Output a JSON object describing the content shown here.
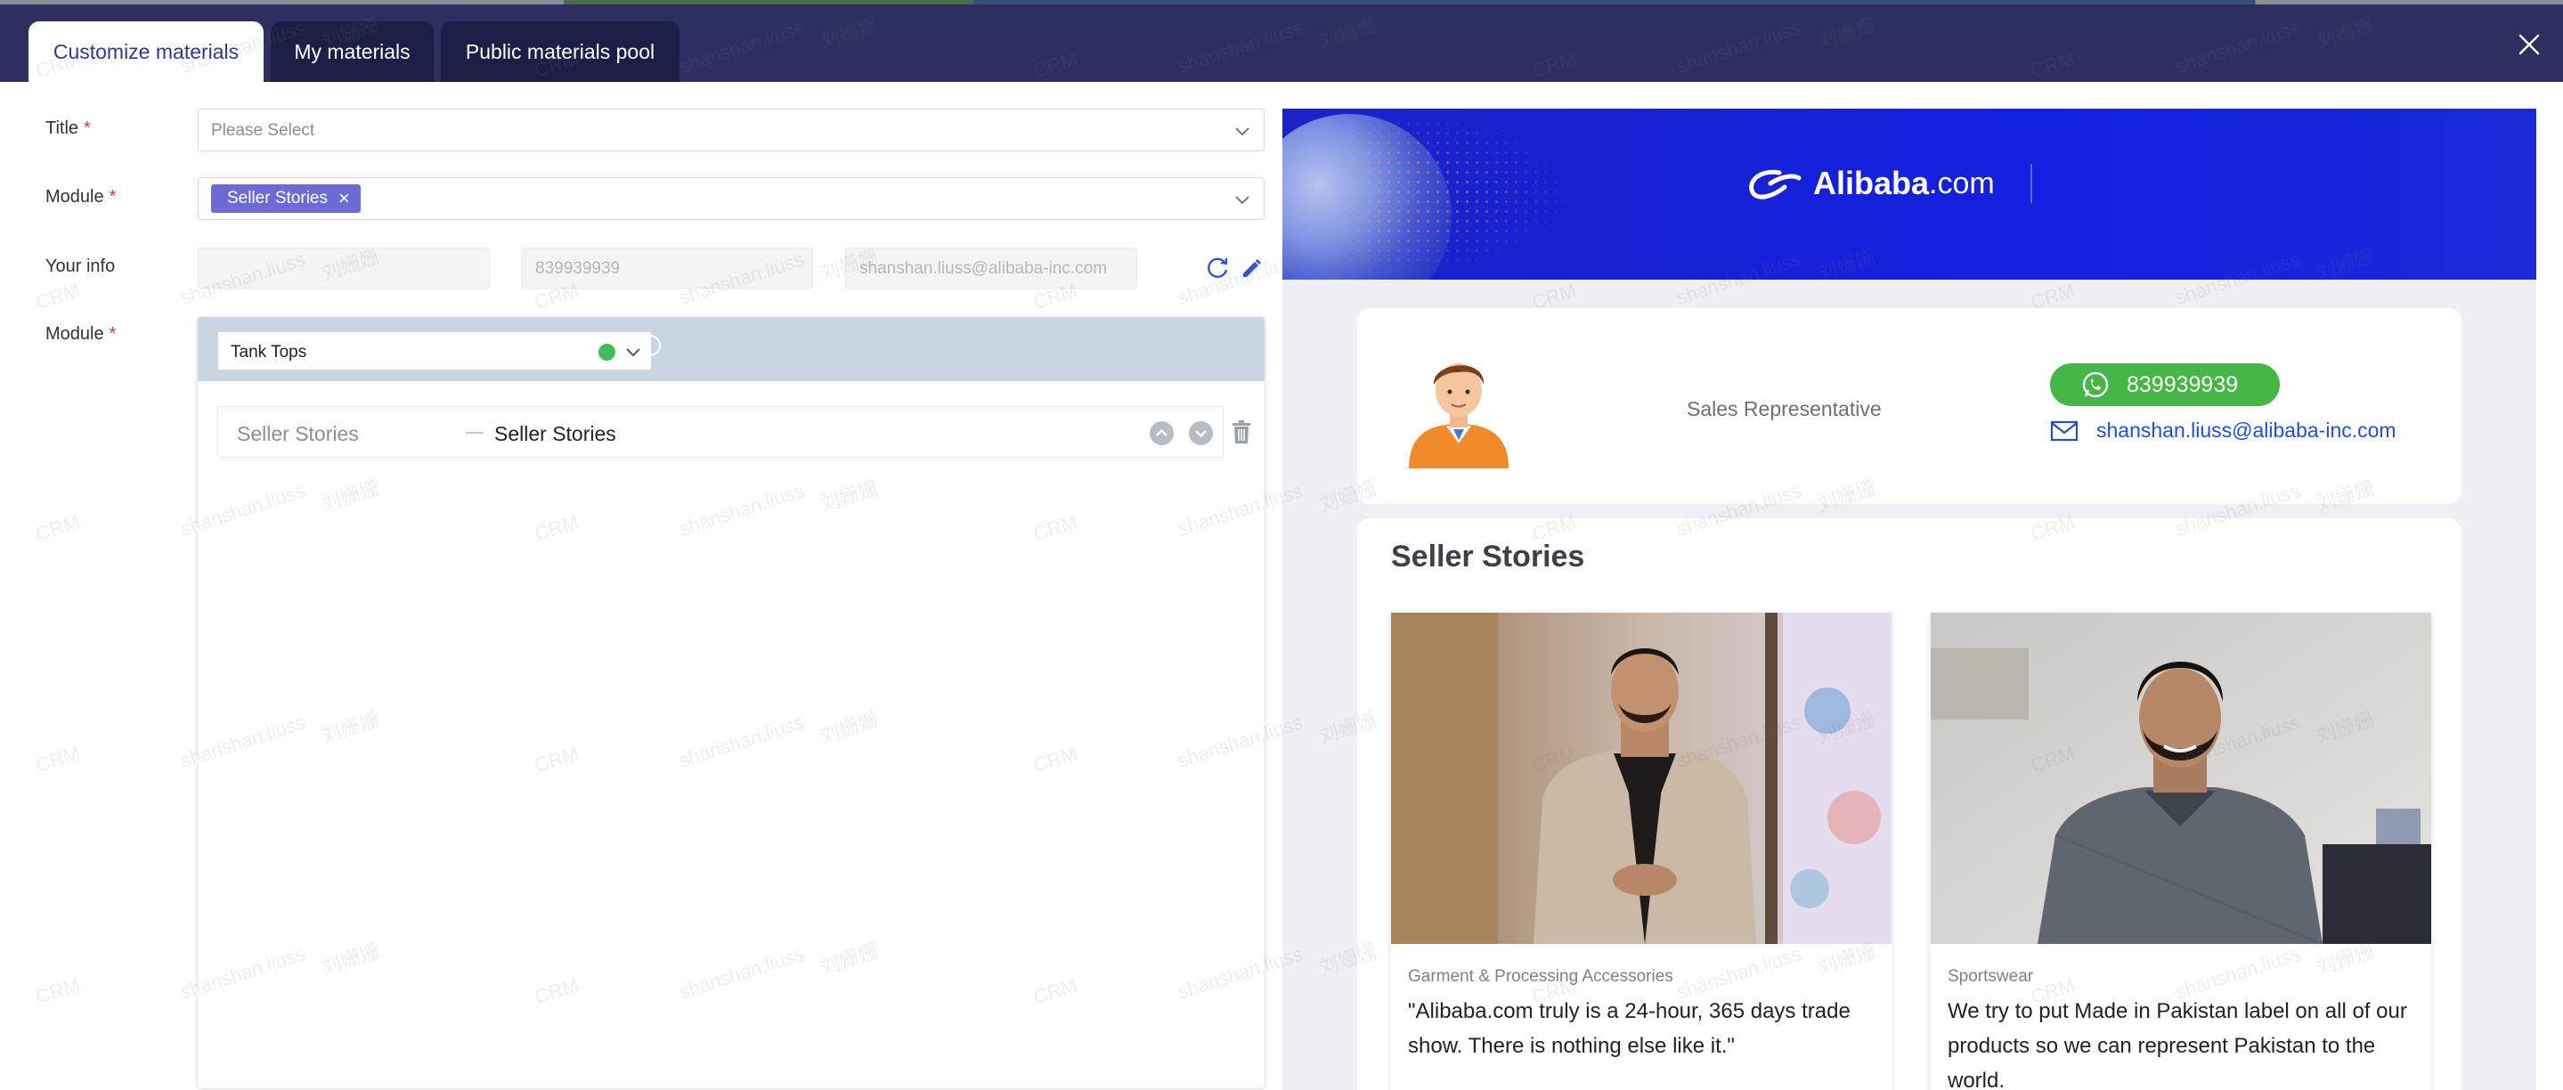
{
  "tabs": [
    {
      "label": "Customize materials",
      "active": true
    },
    {
      "label": "My materials",
      "active": false
    },
    {
      "label": "Public materials pool",
      "active": false
    }
  ],
  "form": {
    "title_label": "Title",
    "title_placeholder": "Please Select",
    "module_label": "Module",
    "module_tag": "Seller Stories",
    "your_info_label": "Your info",
    "info_name": "",
    "info_phone": "839939939",
    "info_email": "shanshan.liuss@alibaba-inc.com",
    "module2_label": "Module",
    "required_mark": "*"
  },
  "module_panel": {
    "selected": "Tank Tops",
    "row": {
      "left": "Seller Stories",
      "right": "Seller Stories"
    }
  },
  "preview": {
    "brand": "Alibaba",
    "brand_domain": ".com",
    "role": "Sales Representative",
    "whatsapp": "839939939",
    "email": "shanshan.liuss@alibaba-inc.com",
    "section_title": "Seller Stories",
    "stories": [
      {
        "category": "Garment & Processing Accessories",
        "quote": "\"Alibaba.com truly is a 24-hour, 365 days trade show. There is nothing else like it.\""
      },
      {
        "category": "Sportswear",
        "quote": "We try to put Made in Pakistan label on all of our products so we can represent Pakistan to the world."
      }
    ]
  },
  "watermark": {
    "crm": "CRM",
    "user": "shanshan.liuss",
    "name": "刘姗姗"
  },
  "colors": {
    "header_bg": "#2c2f5f",
    "tab_bg": "#1c1e45",
    "tag_bg": "#6c6ad6",
    "banner_bg": "#1420e0",
    "whatsapp_green": "#46b646",
    "link_blue": "#1d4fd8",
    "required_red": "#e03b3b"
  }
}
